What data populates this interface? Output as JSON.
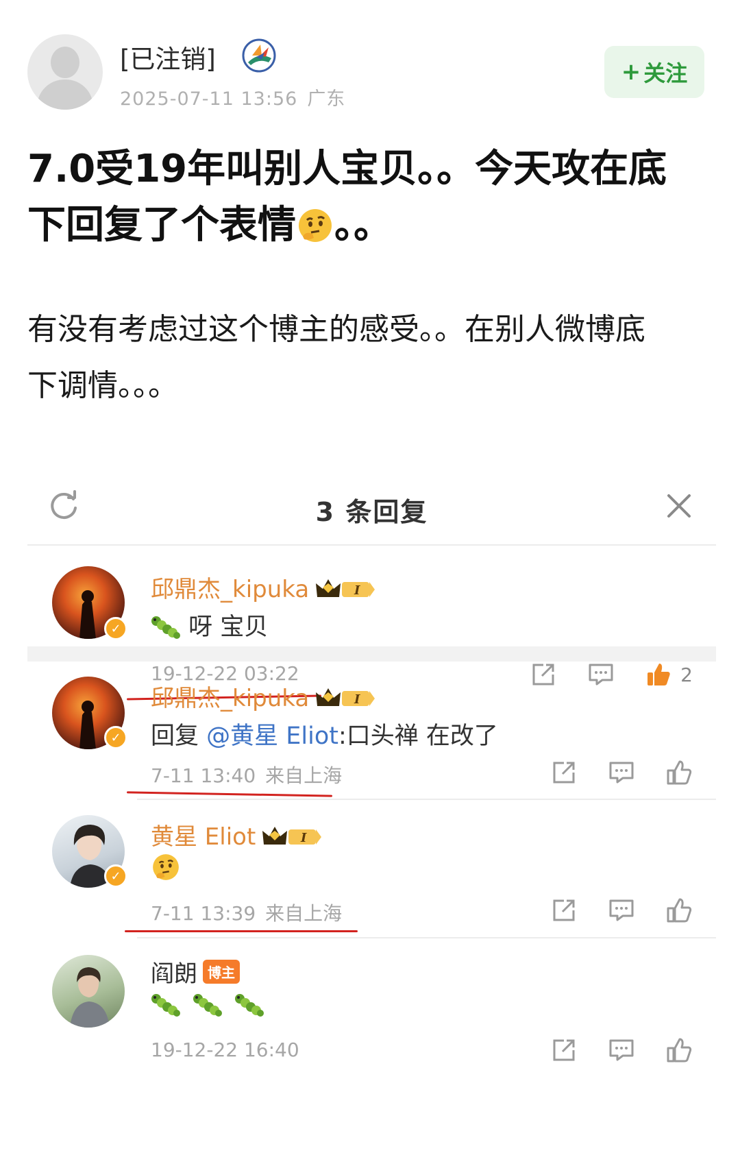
{
  "post": {
    "author": "[已注销]",
    "time": "2025-07-11 13:56",
    "location": "广东",
    "follow_label": "关注",
    "follow_plus": "+",
    "title_line1": "7.0受19年叫别人宝贝。。今天攻在底",
    "title_line2_before": "下回复了个表情",
    "title_line2_after": "。。",
    "body_line1": "有没有考虑过这个博主的感受。。在别人微博底",
    "body_line2": "下调情。。。"
  },
  "replies_panel": {
    "title": "3 条回复",
    "refresh_icon": "refresh-icon",
    "close_icon": "close-icon"
  },
  "replies": [
    {
      "username": "邱鼎杰_kipuka",
      "level": "I",
      "content": "呀 宝贝",
      "time": "19-12-22 03:22",
      "like_count": "2",
      "liked": true
    },
    {
      "username": "邱鼎杰_kipuka",
      "level": "I",
      "reply_prefix": "回复 ",
      "mention": "@黄星 Eliot",
      "reply_text": ":口头禅 在改了",
      "time": "7-11 13:40",
      "location": "来自上海"
    },
    {
      "username": "黄星 Eliot",
      "level": "I",
      "time": "7-11 13:39",
      "location": "来自上海"
    },
    {
      "username": "阎朗",
      "tag": "博主",
      "time": "19-12-22 16:40"
    }
  ],
  "colors": {
    "username": "#e08a3a",
    "mention": "#3f74c6",
    "follow_green": "#2e9a3c",
    "like_orange": "#f08a24",
    "underline_red": "#d2231f"
  }
}
